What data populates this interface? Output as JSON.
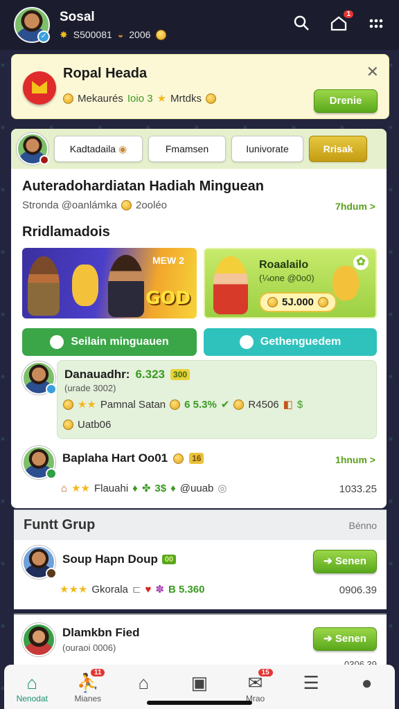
{
  "topbar": {
    "name": "Sosal",
    "coins": "S500081",
    "gems": "2006",
    "notif_count": "1"
  },
  "banner": {
    "title": "Ropal Heada",
    "subtitle_a": "Mekaurés",
    "subtitle_b": "Ioio 3",
    "subtitle_c": "Mrtdks",
    "button": "Drenie"
  },
  "tabs": {
    "tab1": "Kadtadaila",
    "tab2": "Fmamsen",
    "tab3": "Iunivorate",
    "tab4": "Rrisak"
  },
  "main": {
    "headline": "Auteradohardiatan Hadiah Minguean",
    "subline": "Stronda @oanlámka",
    "subline_value": "2ooléo",
    "subline_link": "7hdum >",
    "section_title": "Rridlamadois",
    "promo1_top": "MEW 2",
    "promo1_text": "GOD",
    "promo2_title": "Roaalailo",
    "promo2_sub": "(¼one @0o0)",
    "promo2_value": "5J.000",
    "btn_left": "Seilain minguauen",
    "btn_right": "Gethenguedem"
  },
  "feed": [
    {
      "title": "Danauadhr:",
      "value": "6.323",
      "tag": "300",
      "sub": "(urade 3002)",
      "row": "Pamnal Satan",
      "pct": "6 5.3%",
      "amt": "R4506",
      "extra": "Uatb06"
    },
    {
      "title": "Baplaha Hart Oo01",
      "tag": "16",
      "link": "1hnum >",
      "row": "Flauahi",
      "mid": "3$",
      "handle": "@uuab",
      "amount": "1033.25"
    }
  ],
  "group": {
    "title": "Funtt Grup",
    "link": "Bénno",
    "rows": [
      {
        "title": "Soup Hapn Doup",
        "tag": "00",
        "row": "Gkorala",
        "value": "B 5.360",
        "amount": "0906.39",
        "button": "Senen"
      },
      {
        "title": "Dlamkbn Fied",
        "sub": "(ouraoi 0006)",
        "button": "Senen",
        "amount": "0306.39"
      }
    ]
  },
  "nav": [
    {
      "label": "Nenodat",
      "icon": "home-icon",
      "badge": ""
    },
    {
      "label": "Mianes",
      "icon": "run-icon",
      "badge": "11"
    },
    {
      "label": "",
      "icon": "recycle-icon",
      "badge": ""
    },
    {
      "label": "",
      "icon": "camera-icon",
      "badge": ""
    },
    {
      "label": "Mrao",
      "icon": "inbox-icon",
      "badge": "15"
    },
    {
      "label": "",
      "icon": "list-icon",
      "badge": ""
    },
    {
      "label": "",
      "icon": "profile-icon",
      "badge": ""
    }
  ]
}
